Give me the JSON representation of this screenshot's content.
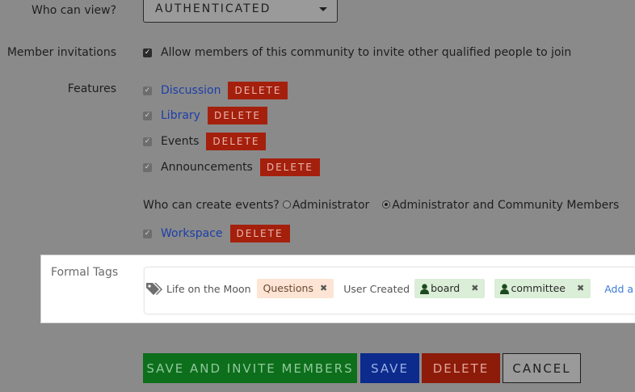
{
  "visibility": {
    "label": "Who can view?",
    "selected": "AUTHENTICATED"
  },
  "invitations": {
    "label": "Member invitations",
    "checkbox_label": "Allow members of this community to invite other qualified people to join"
  },
  "features": {
    "label": "Features",
    "delete_label": "DELETE",
    "discussion": "Discussion",
    "library": "Library",
    "events": "Events",
    "announcements": "Announcements",
    "workspace": "Workspace"
  },
  "events_permission": {
    "question": "Who can create events?",
    "option_admin": "Administrator",
    "option_admin_members": "Administrator and Community Members",
    "selected": "Administrator and Community Members"
  },
  "formal_tags": {
    "label": "Formal Tags",
    "tag_text": "Life on the Moon",
    "chip_questions": "Questions",
    "user_created": "User Created",
    "chip_board": "board",
    "chip_committee": "committee",
    "add_tag": "Add a tag"
  },
  "actions": {
    "save_invite": "SAVE AND INVITE MEMBERS",
    "save": "SAVE",
    "delete": "DELETE",
    "cancel": "CANCEL"
  },
  "colors": {
    "overlay": "#8a8a8a",
    "delete_red": "#a4200d",
    "link_blue": "#1c3fa8",
    "save_green": "#0d6e1c",
    "save_blue": "#0c2b8c",
    "tag_questions_bg": "#fde4d4",
    "tag_user_bg": "#dbeed8"
  }
}
